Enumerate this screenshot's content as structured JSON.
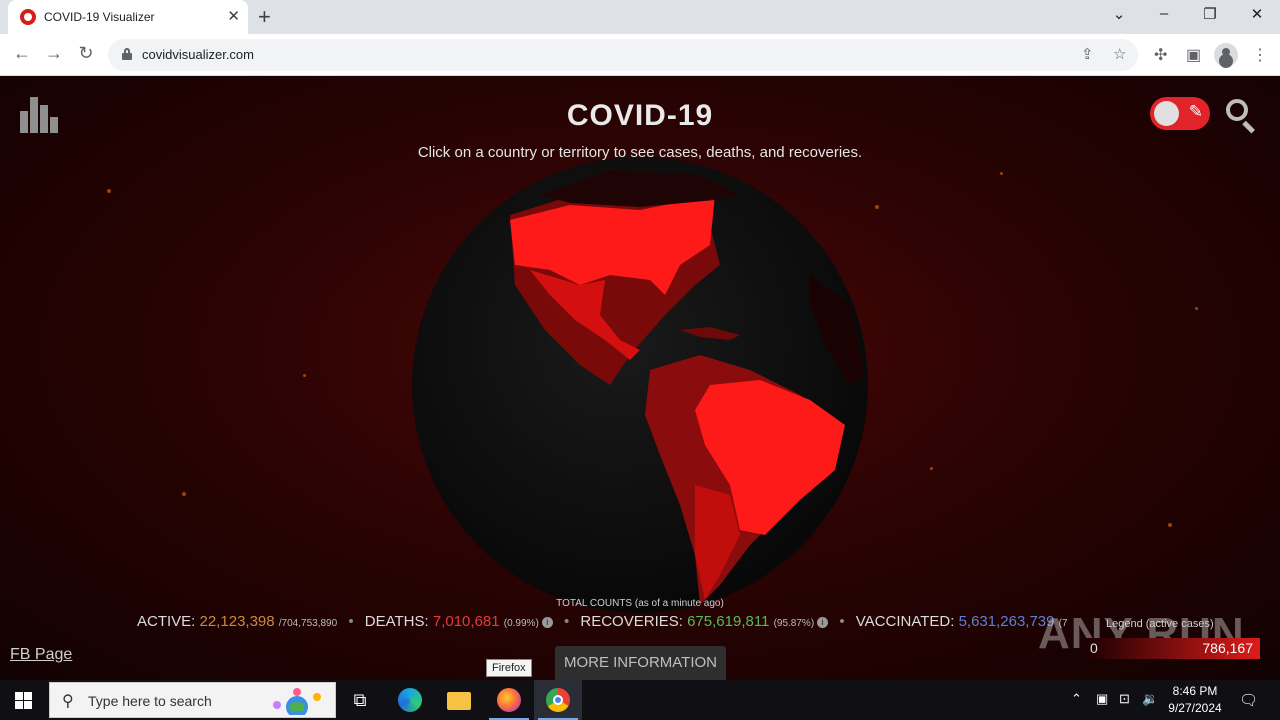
{
  "browser": {
    "tab_title": "COVID-19 Visualizer",
    "url": "covidvisualizer.com"
  },
  "page": {
    "title": "COVID-19",
    "subtitle": "Click on a country or territory to see cases, deaths, and recoveries.",
    "total_label": "TOTAL COUNTS (as of a minute ago)",
    "stats": {
      "active_label": "ACTIVE:",
      "active_value": "22,123,398",
      "active_total": "/704,753,890",
      "deaths_label": "DEATHS:",
      "deaths_value": "7,010,681",
      "deaths_pct": "(0.99%)",
      "recoveries_label": "RECOVERIES:",
      "recoveries_value": "675,619,811",
      "recoveries_pct": "(95.87%)",
      "vaccinated_label": "VACCINATED:",
      "vaccinated_value": "5,631,263,739",
      "vaccinated_pct": "(7"
    },
    "fb_link": "FB Page",
    "more_button": "MORE INFORMATION",
    "legend_label": "Legend (active cases)",
    "legend_min": "0",
    "legend_max": "786,167",
    "watermark": "ANY RUN",
    "tooltip": "Firefox"
  },
  "taskbar": {
    "search_placeholder": "Type here to search",
    "time": "8:46 PM",
    "date": "9/27/2024"
  },
  "colors": {
    "active": "#c98a3c",
    "deaths": "#e03b3b",
    "recoveries": "#5bb85b",
    "vaccinated": "#5e7fd6",
    "accent_red": "#e0242a"
  },
  "icons": [
    "close-icon",
    "plus-icon",
    "back-icon",
    "forward-icon",
    "reload-icon",
    "lock-icon",
    "share-icon",
    "star-icon",
    "extensions-icon",
    "sidepanel-icon",
    "profile-icon",
    "menu-icon",
    "chart-logo-icon",
    "syringe-icon",
    "search-icon",
    "info-icon",
    "windows-start-icon",
    "edge-icon",
    "explorer-icon",
    "firefox-icon",
    "chrome-icon",
    "task-view-icon"
  ]
}
